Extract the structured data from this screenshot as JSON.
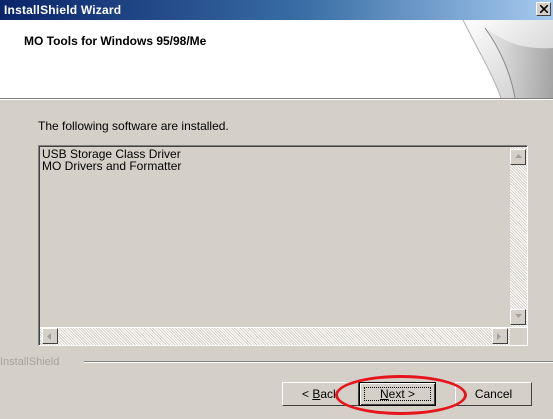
{
  "window": {
    "title": "InstallShield Wizard"
  },
  "header": {
    "title": "MO Tools for Windows 95/98/Me"
  },
  "body": {
    "instruction": "The following software are installed."
  },
  "installed_list": {
    "items": [
      "USB Storage Class Driver",
      "MO Drivers and Formatter"
    ]
  },
  "branding": {
    "label": "InstallShield"
  },
  "buttons": {
    "back": {
      "prefix": "< ",
      "mnemonic": "B",
      "rest": "ack"
    },
    "next": {
      "mnemonic": "N",
      "rest": "ext >"
    },
    "cancel": "Cancel"
  },
  "annotation": {
    "color": "#e8141c"
  },
  "colors": {
    "titlebar_start": "#0a246a",
    "titlebar_end": "#a6caf0",
    "dialog_bg": "#d4d0c8"
  }
}
